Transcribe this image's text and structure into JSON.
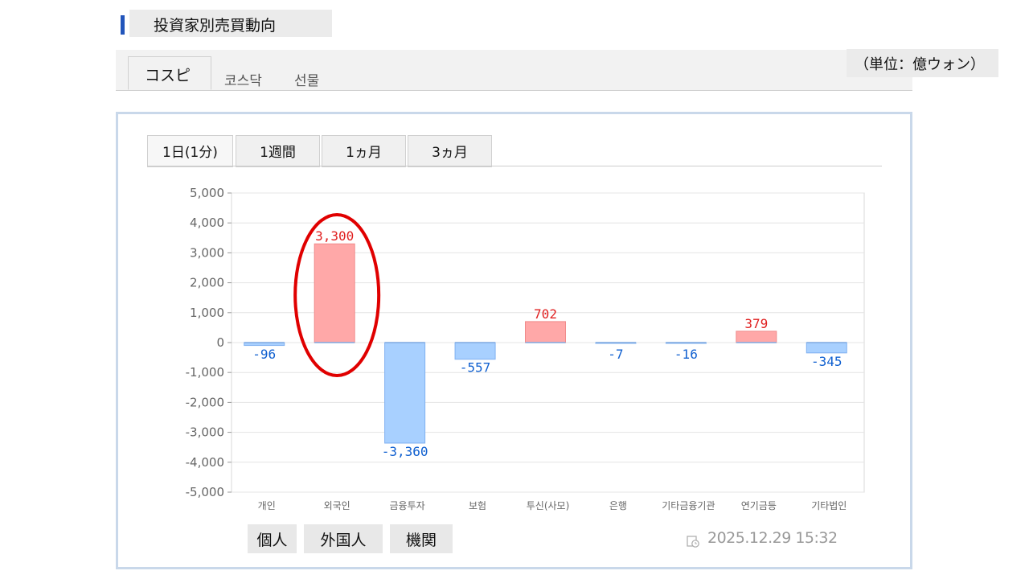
{
  "section": {
    "title": "投資家別売買動向"
  },
  "market_tabs": [
    {
      "label": "コスピ",
      "active": true
    },
    {
      "label": "코스닥",
      "active": false
    },
    {
      "label": "선물",
      "active": false
    }
  ],
  "unit_label": "（単位：億ウォン）",
  "period_tabs": [
    {
      "label": "1日(1分)",
      "active": true
    },
    {
      "label": "1週間",
      "active": false
    },
    {
      "label": "1ヵ月",
      "active": false
    },
    {
      "label": "3ヵ月",
      "active": false
    }
  ],
  "groups": [
    "個人",
    "外国人",
    "機関"
  ],
  "timestamp": "2025.12.29 15:32",
  "icons": {
    "timestamp": "clock-icon"
  },
  "colors": {
    "positive_fill": "#ffa8a8",
    "negative_fill": "#a8d0ff",
    "positive_text": "#e02020",
    "negative_text": "#1060d0",
    "highlight": "#e00000",
    "title_accent": "#2255bb"
  },
  "chart_data": {
    "type": "bar",
    "categories": [
      "개인",
      "외국인",
      "금융투자",
      "보험",
      "투신(사모)",
      "은행",
      "기타금융기관",
      "연기금등",
      "기타법인"
    ],
    "values": [
      -96,
      3300,
      -3360,
      -557,
      702,
      -7,
      -16,
      379,
      -345
    ],
    "value_labels": [
      "-96",
      "3,300",
      "-3,360",
      "-557",
      "702",
      "-7",
      "-16",
      "379",
      "-345"
    ],
    "ylim": [
      -5000,
      5000
    ],
    "yticks": [
      5000,
      4000,
      3000,
      2000,
      1000,
      0,
      -1000,
      -2000,
      -3000,
      -4000,
      -5000
    ],
    "ytick_labels": [
      "5,000",
      "4,000",
      "3,000",
      "2,000",
      "1,000",
      "0",
      "-1,000",
      "-2,000",
      "-3,000",
      "-4,000",
      "-5,000"
    ],
    "grid": true,
    "highlighted_category": "외국인"
  }
}
